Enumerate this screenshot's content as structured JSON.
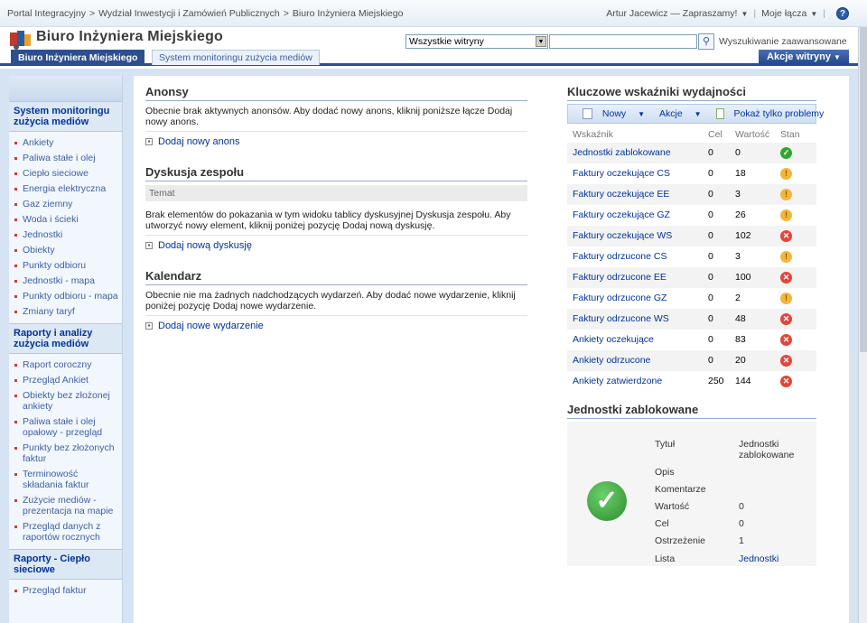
{
  "topbar": {
    "breadcrumb": [
      "Portal Integracyjny",
      "Wydział Inwestycji i Zamówień Publicznych",
      "Biuro Inżyniera Miejskiego"
    ],
    "breadcrumb_sep": ">",
    "welcome": "Artur Jacewicz — Zapraszamy!",
    "my_links": "Moje łącza",
    "help": "?"
  },
  "header": {
    "site_title": "Biuro Inżyniera Miejskiego",
    "scope": "Wszystkie witryny",
    "search_value": "",
    "advanced_search": "Wyszukiwanie zaawansowane"
  },
  "tabs": [
    {
      "label": "Biuro Inżyniera Miejskiego",
      "active": true
    },
    {
      "label": "System monitoringu zużycia mediów",
      "active": false
    }
  ],
  "site_actions": "Akcje witryny",
  "nav": {
    "sections": [
      {
        "title": "System monitoringu zużycia mediów",
        "items": [
          "Ankiety",
          "Paliwa stałe i olej",
          "Ciepło sieciowe",
          "Energia elektryczna",
          "Gaz ziemny",
          "Woda i ścieki",
          "Jednostki",
          "Obiekty",
          "Punkty odbioru",
          "Jednostki - mapa",
          "Punkty odbioru - mapa",
          "Zmiany taryf"
        ]
      },
      {
        "title": "Raporty i analizy zużycia mediów",
        "items": [
          "Raport coroczny",
          "Przegląd Ankiet",
          "Obiekty bez złożonej ankiety",
          "Paliwa stałe i olej opałowy - przegląd",
          "Punkty bez złożonych faktur",
          "Terminowość składania faktur",
          "Zużycie mediów - prezentacja na mapie",
          "Przegląd danych z raportów rocznych"
        ]
      },
      {
        "title": "Raporty - Ciepło sieciowe",
        "items": [
          "Przegląd faktur"
        ]
      }
    ]
  },
  "announcements": {
    "title": "Anonsy",
    "body": "Obecnie brak aktywnych anonsów. Aby dodać nowy anons, kliknij poniższe łącze Dodaj nowy anons.",
    "add": "Dodaj nowy anons"
  },
  "discussion": {
    "title": "Dyskusja zespołu",
    "column": "Temat",
    "body": "Brak elementów do pokazania w tym widoku tablicy dyskusyjnej Dyskusja zespołu. Aby utworzyć nowy element, kliknij poniżej pozycję Dodaj nową dyskusję.",
    "add": "Dodaj nową dyskusję"
  },
  "calendar": {
    "title": "Kalendarz",
    "body": "Obecnie nie ma żadnych nadchodzących wydarzeń. Aby dodać nowe wydarzenie, kliknij poniżej pozycję Dodaj nowe wydarzenie.",
    "add": "Dodaj nowe wydarzenie"
  },
  "kpi": {
    "title": "Kluczowe wskaźniki wydajności",
    "toolbar": {
      "new": "Nowy",
      "actions": "Akcje",
      "show_problems": "Pokaż tylko problemy"
    },
    "columns": {
      "indicator": "Wskaźnik",
      "goal": "Cel",
      "value": "Wartość",
      "status": "Stan"
    },
    "rows": [
      {
        "name": "Jednostki zablokowane",
        "goal": "0",
        "value": "0",
        "status": "g"
      },
      {
        "name": "Faktury oczekujące CS",
        "goal": "0",
        "value": "18",
        "status": "y"
      },
      {
        "name": "Faktury oczekujące EE",
        "goal": "0",
        "value": "3",
        "status": "y"
      },
      {
        "name": "Faktury oczekujące GZ",
        "goal": "0",
        "value": "26",
        "status": "y"
      },
      {
        "name": "Faktury oczekujące WS",
        "goal": "0",
        "value": "102",
        "status": "r"
      },
      {
        "name": "Faktury odrzucone CS",
        "goal": "0",
        "value": "3",
        "status": "y"
      },
      {
        "name": "Faktury odrzucone EE",
        "goal": "0",
        "value": "100",
        "status": "r"
      },
      {
        "name": "Faktury odrzucone GZ",
        "goal": "0",
        "value": "2",
        "status": "y"
      },
      {
        "name": "Faktury odrzucone WS",
        "goal": "0",
        "value": "48",
        "status": "r"
      },
      {
        "name": "Ankiety oczekujące",
        "goal": "0",
        "value": "83",
        "status": "r"
      },
      {
        "name": "Ankiety odrzucone",
        "goal": "0",
        "value": "20",
        "status": "r"
      },
      {
        "name": "Ankiety zatwierdzone",
        "goal": "250",
        "value": "144",
        "status": "r"
      }
    ],
    "status_colors": {
      "g": "#2fa82f",
      "y": "#f2b63a",
      "r": "#e2463a"
    }
  },
  "detail": {
    "title": "Jednostki zablokowane",
    "labels": {
      "title": "Tytuł",
      "desc": "Opis",
      "comments": "Komentarze",
      "value": "Wartość",
      "goal": "Cel",
      "warning": "Ostrzeżenie",
      "list": "Lista"
    },
    "values": {
      "title": "Jednostki zablokowane",
      "value": "0",
      "goal": "0",
      "warning": "1",
      "list": "Jednostki"
    }
  }
}
